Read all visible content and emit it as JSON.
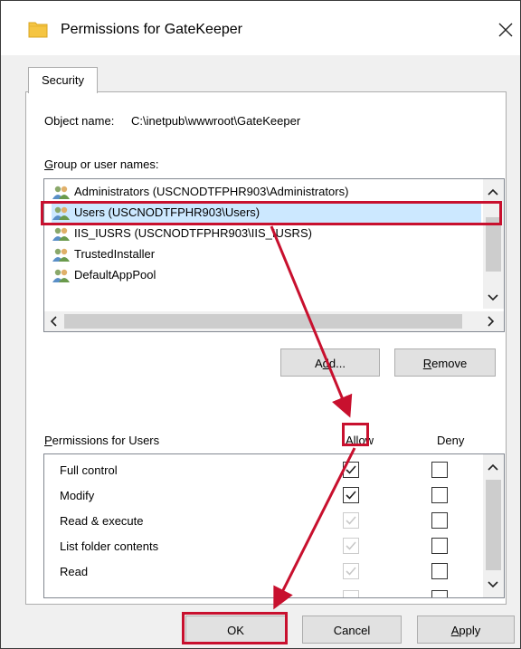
{
  "window": {
    "title": "Permissions for GateKeeper",
    "close_glyph": "✕"
  },
  "tabs": [
    {
      "label": "Security",
      "active": true
    }
  ],
  "object": {
    "label": "Object name:",
    "value": "C:\\inetpub\\wwwroot\\GateKeeper"
  },
  "group": {
    "label_accesskey": "G",
    "label_rest": "roup or user names:",
    "items": [
      {
        "label": "Administrators (USCNODTFPHR903\\Administrators)"
      },
      {
        "label": "Users (USCNODTFPHR903\\Users)",
        "selected": true
      },
      {
        "label": "IIS_IUSRS (USCNODTFPHR903\\IIS_IUSRS)"
      },
      {
        "label": "TrustedInstaller"
      },
      {
        "label": "DefaultAppPool"
      }
    ],
    "add_label_pre": "A",
    "add_label_key": "d",
    "add_label_post": "d...",
    "remove_label_key": "R",
    "remove_label_rest": "emove"
  },
  "permissions": {
    "label_accesskey": "P",
    "label_rest": "ermissions for Users",
    "allow_header": "Allow",
    "deny_header": "Deny",
    "rows": [
      {
        "name": "Full control",
        "allow": true,
        "allow_disabled": false,
        "deny": false
      },
      {
        "name": "Modify",
        "allow": true,
        "allow_disabled": false,
        "deny": false
      },
      {
        "name": "Read & execute",
        "allow": true,
        "allow_disabled": true,
        "deny": false
      },
      {
        "name": "List folder contents",
        "allow": true,
        "allow_disabled": true,
        "deny": false
      },
      {
        "name": "Read",
        "allow": true,
        "allow_disabled": true,
        "deny": false
      }
    ]
  },
  "footer": {
    "ok_label": "OK",
    "cancel_label": "Cancel",
    "apply_accesskey": "A",
    "apply_rest": "pply"
  },
  "colors": {
    "annotation": "#c8102e",
    "selection": "#cce8ff",
    "folder": "#f5c542"
  }
}
